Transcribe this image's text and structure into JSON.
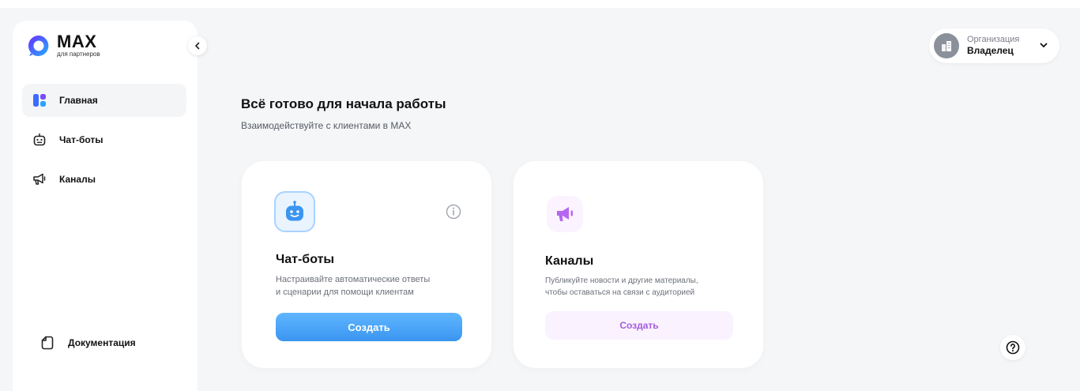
{
  "brand": {
    "name": "MAX",
    "subtitle": "для партнеров",
    "colors": {
      "logo_gradient_start": "#5a33ff",
      "logo_gradient_end": "#29a3ff"
    }
  },
  "sidebar": {
    "items": [
      {
        "label": "Главная",
        "icon": "dashboard-icon",
        "active": true
      },
      {
        "label": "Чат-боты",
        "icon": "robot-icon",
        "active": false
      },
      {
        "label": "Каналы",
        "icon": "megaphone-icon",
        "active": false
      }
    ],
    "docs_label": "Документация"
  },
  "profile": {
    "org_label": "Организация",
    "role": "Владелец"
  },
  "main": {
    "title": "Всё готово для начала работы",
    "subtitle": "Взаимодействуйте с клиентами в MAX"
  },
  "cards": {
    "bots": {
      "title": "Чат-боты",
      "description": "Настраивайте автоматические ответы\nи сценарии для помощи клиентам",
      "button": "Создать",
      "accent": "#3b95f0"
    },
    "channels": {
      "title": "Каналы",
      "description": "Публикуйте новости и другие материалы,\nчтобы оставаться на связи с аудиторией",
      "button": "Создать",
      "accent": "#a45be0"
    }
  }
}
